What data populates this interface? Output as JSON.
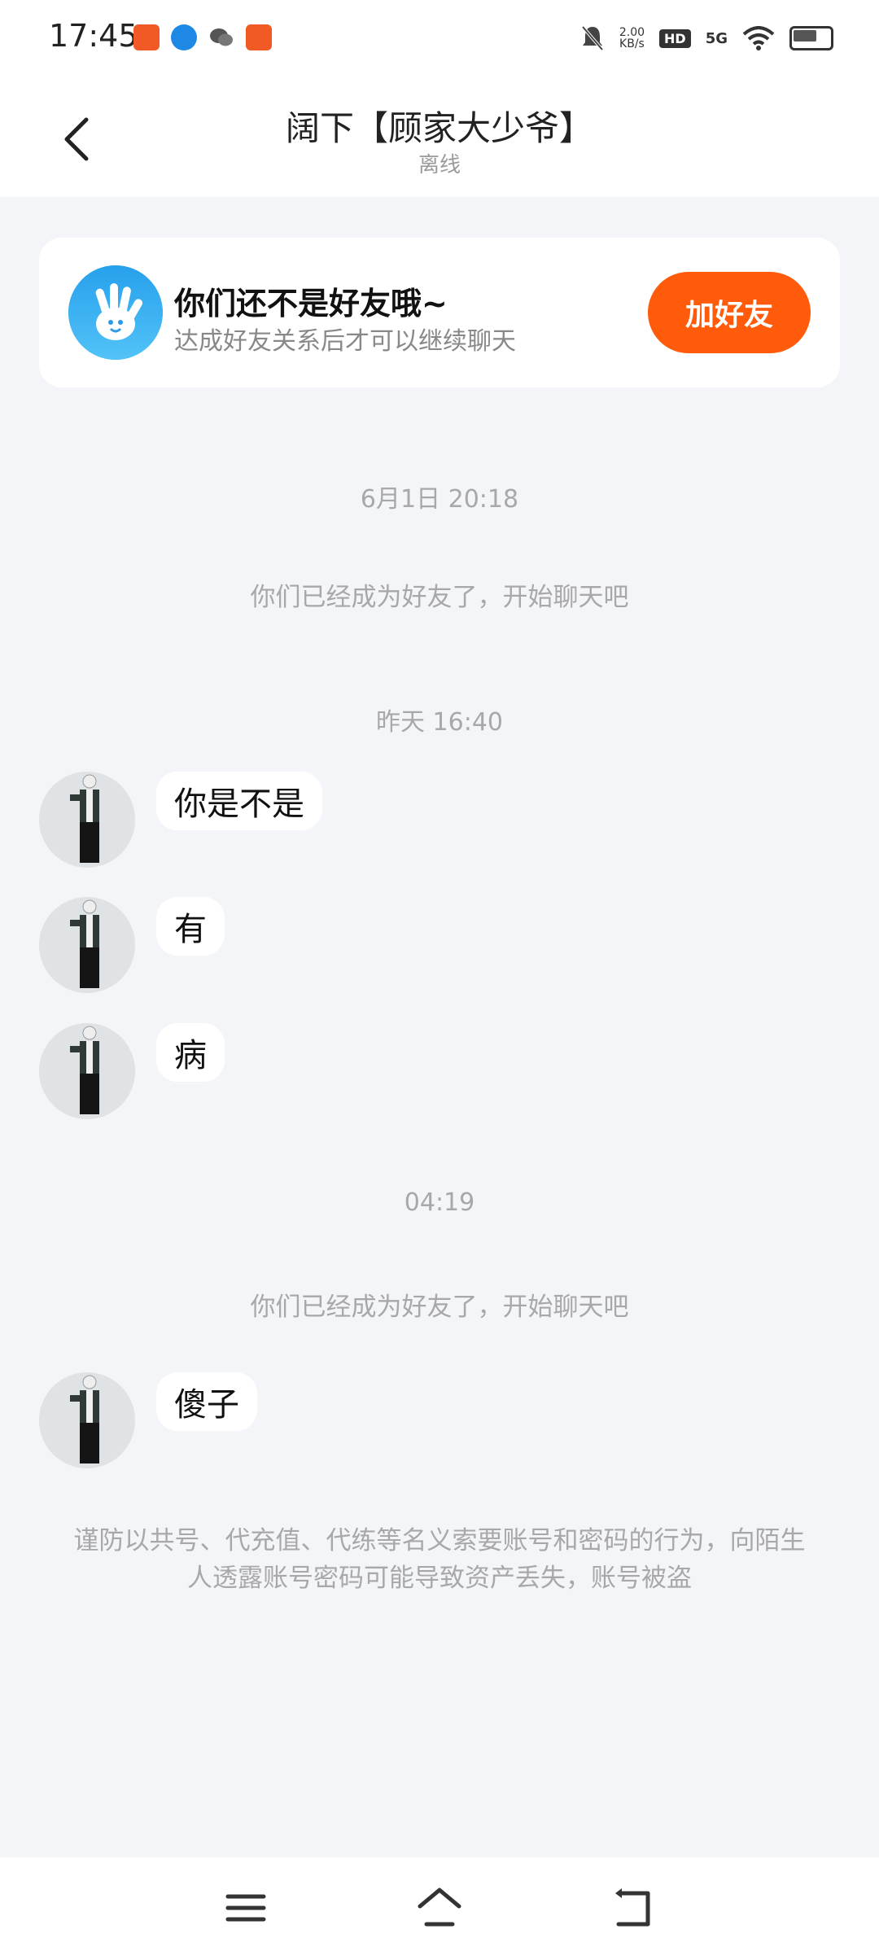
{
  "status_bar": {
    "time": "17:45",
    "net_speed": "2.00",
    "net_unit": "KB/s",
    "hd_badge": "HD",
    "network_type": "5G"
  },
  "header": {
    "title": "阔下【顾家大少爷】",
    "status": "离线"
  },
  "friend_card": {
    "title": "你们还不是好友哦~",
    "subtitle": "达成好友关系后才可以继续聊天",
    "button_label": "加好友",
    "accent_color": "#ff5b0a"
  },
  "chat": {
    "timestamp_1": "6月1日 20:18",
    "system_msg_1": "你们已经成为好友了，开始聊天吧",
    "timestamp_2": "昨天 16:40",
    "messages": [
      "你是不是",
      "有",
      "病"
    ],
    "timestamp_3": "04:19",
    "system_msg_2": "你们已经成为好友了，开始聊天吧",
    "last_message": "傻子"
  },
  "warning": "谨防以共号、代充值、代练等名义索要账号和密码的行为，向陌生人透露账号密码可能导致资产丢失，账号被盗"
}
